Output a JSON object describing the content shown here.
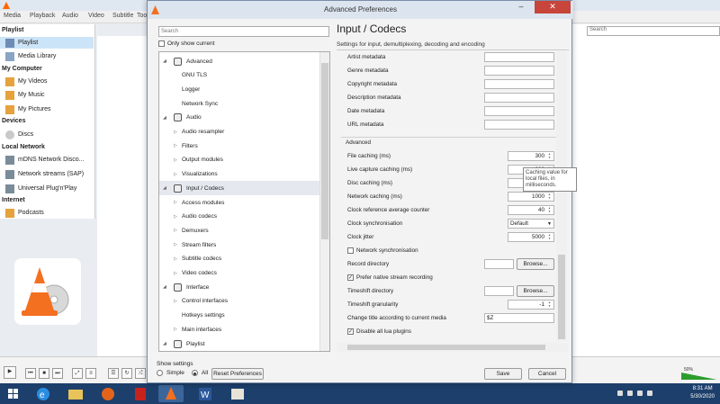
{
  "vlc": {
    "menu": [
      "Media",
      "Playback",
      "Audio",
      "Video",
      "Subtitle",
      "Tools"
    ],
    "search_placeholder": "Search",
    "sidebar": {
      "sections": [
        {
          "title": "Playlist"
        },
        {
          "title": "My Computer"
        },
        {
          "title": "Devices"
        },
        {
          "title": "Local Network"
        },
        {
          "title": "Internet"
        }
      ],
      "items": [
        {
          "label": "Playlist"
        },
        {
          "label": "Media Library"
        },
        {
          "label": "My Videos"
        },
        {
          "label": "My Music"
        },
        {
          "label": "My Pictures"
        },
        {
          "label": "Discs"
        },
        {
          "label": "mDNS Network Disco..."
        },
        {
          "label": "Network streams (SAP)"
        },
        {
          "label": "Universal Plug'n'Play"
        },
        {
          "label": "Podcasts"
        }
      ]
    },
    "time_left": "--:--",
    "time_right": "--:--",
    "volume_label": "50%"
  },
  "dialog": {
    "title": "Advanced Preferences",
    "search_placeholder": "Search",
    "only_current": "Only show current",
    "tree": [
      {
        "label": "Advanced",
        "level": 0,
        "expanded": true
      },
      {
        "label": "GNU TLS",
        "level": 1
      },
      {
        "label": "Logger",
        "level": 1
      },
      {
        "label": "Network Sync",
        "level": 1
      },
      {
        "label": "Audio",
        "level": 0,
        "expanded": true
      },
      {
        "label": "Audio resampler",
        "level": 1,
        "has_children": true
      },
      {
        "label": "Filters",
        "level": 1,
        "has_children": true
      },
      {
        "label": "Output modules",
        "level": 1,
        "has_children": true
      },
      {
        "label": "Visualizations",
        "level": 1,
        "has_children": true
      },
      {
        "label": "Input / Codecs",
        "level": 0,
        "expanded": true,
        "selected": true
      },
      {
        "label": "Access modules",
        "level": 1,
        "has_children": true
      },
      {
        "label": "Audio codecs",
        "level": 1,
        "has_children": true
      },
      {
        "label": "Demuxers",
        "level": 1,
        "has_children": true
      },
      {
        "label": "Stream filters",
        "level": 1,
        "has_children": true
      },
      {
        "label": "Subtitle codecs",
        "level": 1,
        "has_children": true
      },
      {
        "label": "Video codecs",
        "level": 1,
        "has_children": true
      },
      {
        "label": "Interface",
        "level": 0,
        "expanded": true
      },
      {
        "label": "Control interfaces",
        "level": 1,
        "has_children": true
      },
      {
        "label": "Hotkeys settings",
        "level": 1
      },
      {
        "label": "Main interfaces",
        "level": 1,
        "has_children": true
      },
      {
        "label": "Playlist",
        "level": 0,
        "expanded": true
      }
    ],
    "show_settings": "Show settings",
    "radio_simple": "Simple",
    "radio_all": "All",
    "reset_button": "Reset Preferences",
    "save_button": "Save",
    "cancel_button": "Cancel",
    "panel": {
      "title": "Input / Codecs",
      "subtitle": "Settings for input, demultiplexing, decoding and encoding",
      "metadata_fields": [
        {
          "label": "Artist metadata",
          "value": ""
        },
        {
          "label": "Genre metadata",
          "value": ""
        },
        {
          "label": "Copyright metadata",
          "value": ""
        },
        {
          "label": "Description metadata",
          "value": ""
        },
        {
          "label": "Date metadata",
          "value": ""
        },
        {
          "label": "URL metadata",
          "value": ""
        }
      ],
      "advanced_title": "Advanced",
      "file_caching": {
        "label": "File caching (ms)",
        "value": "300"
      },
      "live_capture": {
        "label": "Live capture caching (ms)",
        "value": "300"
      },
      "disc_caching": {
        "label": "Disc caching (ms)",
        "value": "300"
      },
      "network_caching": {
        "label": "Network caching (ms)",
        "value": "1000"
      },
      "clock_ref": {
        "label": "Clock reference average counter",
        "value": "40"
      },
      "clock_sync": {
        "label": "Clock synchronisation",
        "value": "Default"
      },
      "clock_jitter": {
        "label": "Clock jitter",
        "value": "5000"
      },
      "network_sync": {
        "label": "Network synchronisation",
        "checked": false
      },
      "record_dir": {
        "label": "Record directory",
        "value": "",
        "browse": "Browse..."
      },
      "prefer_native": {
        "label": "Prefer native stream recording",
        "checked": true
      },
      "timeshift_dir": {
        "label": "Timeshift directory",
        "value": "",
        "browse": "Browse..."
      },
      "timeshift_gran": {
        "label": "Timeshift granularity",
        "value": "-1"
      },
      "change_title": {
        "label": "Change title according to current media",
        "value": "$Z"
      },
      "disable_lua": {
        "label": "Disable all lua plugins",
        "checked": true
      }
    },
    "tooltip": "Caching value for local files, in milliseconds."
  },
  "taskbar": {
    "time": "8:31 AM",
    "date": "5/30/2020"
  }
}
